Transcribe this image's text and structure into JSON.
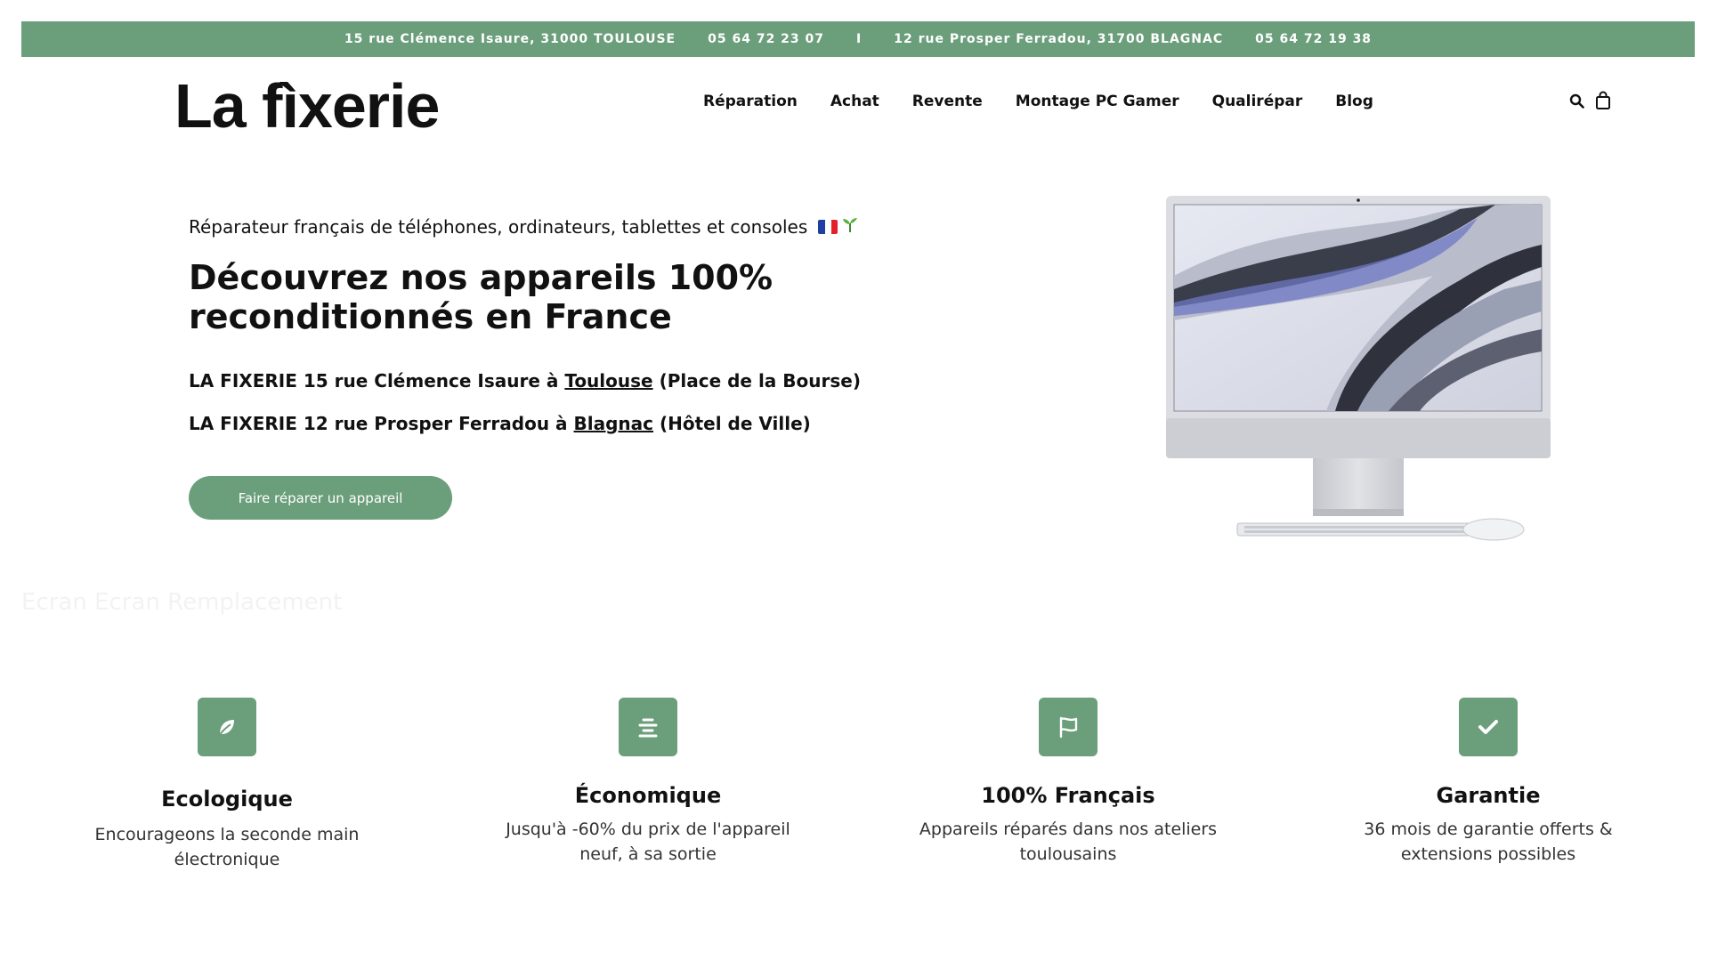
{
  "topbar": {
    "address1": "15 rue Clémence Isaure, 31000 TOULOUSE",
    "phone1": "05 64 72 23 07",
    "separator": "I",
    "address2": "12 rue Prosper Ferradou, 31700 BLAGNAC",
    "phone2": "05 64 72 19 38"
  },
  "header": {
    "logo": "La fìxerie",
    "nav": [
      "Réparation",
      "Achat",
      "Revente",
      "Montage PC Gamer",
      "Qualirépar",
      "Blog"
    ],
    "icons": [
      "search-icon",
      "cart-icon"
    ]
  },
  "hero": {
    "subtitle": "Réparateur français de téléphones, ordinateurs, tablettes et consoles",
    "title": "Découvrez nos appareils 100% reconditionnés en France",
    "line1_pre": "LA FIXERIE 15 rue Clémence Isaure à ",
    "line1_link": "Toulouse",
    "line1_post": " (Place de la Bourse)",
    "line2_pre": "LA FIXERIE 12 rue Prosper Ferradou à ",
    "line2_link": "Blagnac",
    "line2_post": " (Hôtel de Ville)",
    "cta": "Faire réparer un appareil"
  },
  "ghost_text": "Ecran Ecran Remplacement",
  "features": [
    {
      "icon": "leaf-icon",
      "title": "Ecologique",
      "text": "Encourageons la seconde main électronique"
    },
    {
      "icon": "align-center-icon",
      "title": "Économique",
      "text": "Jusqu'à -60% du prix de l'appareil neuf, à sa sortie"
    },
    {
      "icon": "flag-icon",
      "title": "100% Français",
      "text": "Appareils réparés dans nos ateliers toulousains"
    },
    {
      "icon": "check-icon",
      "title": "Garantie",
      "text": "36 mois de garantie offerts & extensions possibles"
    }
  ],
  "colors": {
    "accent": "#6b9e7b",
    "text": "#111111"
  }
}
